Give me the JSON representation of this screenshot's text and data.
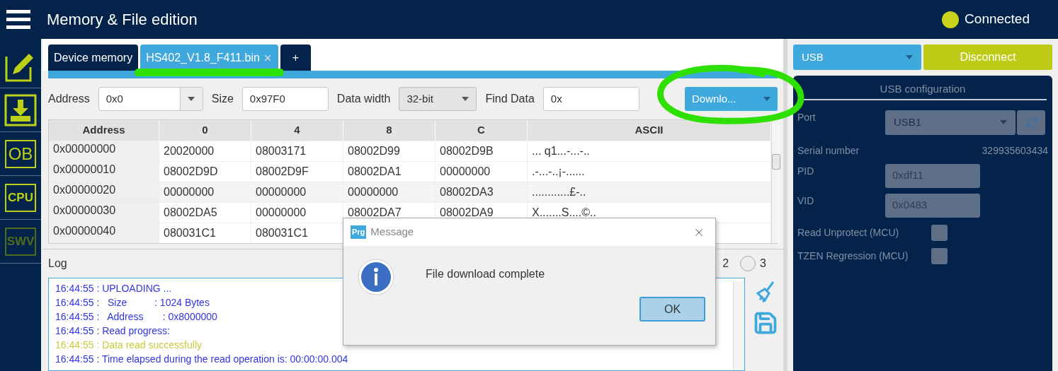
{
  "header": {
    "title": "Memory & File edition",
    "status": {
      "label": "Connected",
      "color": "#c8d41c"
    }
  },
  "sidebar": {
    "items": [
      {
        "kind": "edit",
        "disabled": false
      },
      {
        "kind": "download",
        "disabled": false
      },
      {
        "kind": "text",
        "label": "OB",
        "disabled": false
      },
      {
        "kind": "text",
        "label": "CPU",
        "disabled": false
      },
      {
        "kind": "text",
        "label": "SWV",
        "disabled": true
      }
    ]
  },
  "tabs": [
    {
      "kind": "tab",
      "label": "Device memory",
      "selected": false,
      "closable": false,
      "highlighted": false
    },
    {
      "kind": "tab",
      "label": "HS402_V1.8_F411.bin",
      "selected": true,
      "closable": true,
      "highlighted": true
    },
    {
      "kind": "add",
      "label": "+",
      "selected": false,
      "closable": false,
      "highlighted": false
    }
  ],
  "toolbar": {
    "address": {
      "label": "Address",
      "value": "0x0"
    },
    "size": {
      "label": "Size",
      "value": "0x97F0"
    },
    "data_width": {
      "label": "Data width",
      "value": "32-bit"
    },
    "find": {
      "label": "Find Data",
      "value": "0x"
    },
    "download_button": "Downlo...",
    "download_highlighted": true
  },
  "table": {
    "columns": [
      "Address",
      "0",
      "4",
      "8",
      "C",
      "ASCII"
    ],
    "rows": [
      [
        "0x00000000",
        "20020000",
        "08003171",
        "08002D99",
        "08002D9B",
        "... q1...-...-.."
      ],
      [
        "0x00000010",
        "08002D9D",
        "08002D9F",
        "08002DA1",
        "00000000",
        ".-...-..¡-......"
      ],
      [
        "0x00000020",
        "00000000",
        "00000000",
        "00000000",
        "08002DA3",
        "............£-.."
      ],
      [
        "0x00000030",
        "08002DA5",
        "00000000",
        "08002DA7",
        "08002DA9",
        "X.......S....©.."
      ],
      [
        "0x00000040",
        "080031C1",
        "080031C1",
        "",
        "",
        ""
      ]
    ]
  },
  "log": {
    "label": "Log",
    "verbosity": [
      {
        "label": "2"
      },
      {
        "label": "3",
        "selected": false
      }
    ],
    "lines": [
      {
        "kind": "info",
        "text": "16:44:55 : UPLOADING ..."
      },
      {
        "kind": "info",
        "text": "16:44:55 :   Size          : 1024 Bytes"
      },
      {
        "kind": "info",
        "text": "16:44:55 :   Address       : 0x8000000"
      },
      {
        "kind": "info",
        "text": "16:44:55 : Read progress:"
      },
      {
        "kind": "success",
        "text": "16:44:55 : Data read successfully"
      },
      {
        "kind": "info",
        "text": "16:44:55 : Time elapsed during the read operation is: 00:00:00.004"
      }
    ]
  },
  "connection": {
    "interface": "USB",
    "disconnect_button": "Disconnect",
    "config_title": "USB configuration",
    "port": {
      "label": "Port",
      "value": "USB1",
      "disabled": true
    },
    "serial": {
      "label": "Serial number",
      "value": "329935603434"
    },
    "pid": {
      "label": "PID",
      "value": "0xdf11"
    },
    "vid": {
      "label": "VID",
      "value": "0x0483"
    },
    "options": [
      {
        "label": "Read Unprotect (MCU)",
        "checked": false
      },
      {
        "label": "TZEN Regression (MCU)",
        "checked": false
      }
    ]
  },
  "dialog": {
    "app_icon": "Prg",
    "title": "Message",
    "message": "File download complete",
    "ok_button": "OK"
  }
}
